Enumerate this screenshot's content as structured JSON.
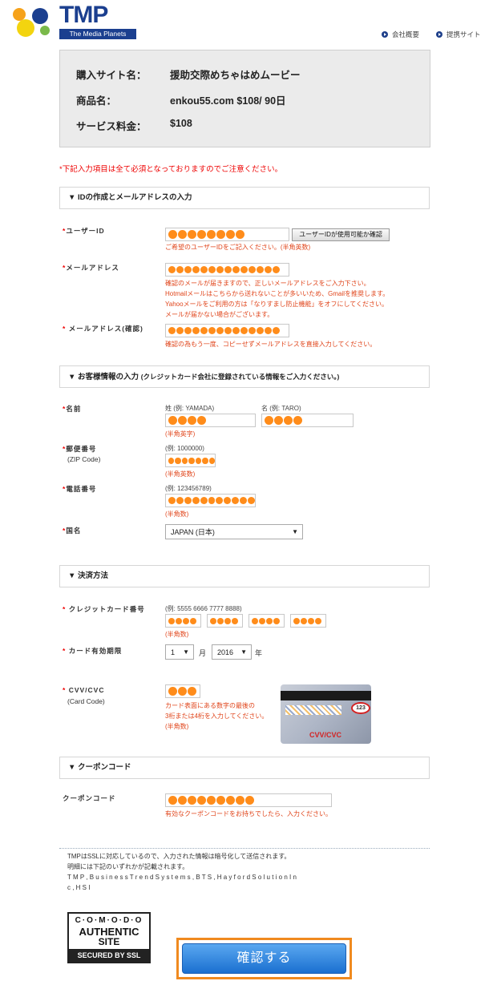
{
  "header": {
    "logo_text": "TMP",
    "logo_sub": "The Media Planets",
    "nav": [
      "会社概要",
      "提携サイト"
    ]
  },
  "summary": {
    "rows": [
      {
        "label": "購入サイト名：",
        "value": "援助交際めちゃはめムービー"
      },
      {
        "label": "商品名：",
        "value": "enkou55.com $108/ 90日"
      },
      {
        "label": "サービス料金：",
        "value": "$108"
      }
    ]
  },
  "notice": "*下記入力項目は全て必須となっておりますのでご注意ください。",
  "sections": {
    "account": "▼ IDの作成とメールアドレスの入力",
    "customer_main": "▼ お客様情報の入力",
    "customer_sub": "(クレジットカード会社に登録されている情報をご入力ください。)",
    "payment": "▼ 決済方法",
    "coupon": "▼ クーポンコード"
  },
  "fields": {
    "user_id": {
      "label": "ユーザーID",
      "check_button": "ユーザーIDが使用可能か確認",
      "hint": "ご希望のユーザーIDをご記入ください。(半角英数)"
    },
    "email": {
      "label": "メールアドレス",
      "hints": [
        "確認のメールが届きますので、正しいメールアドレスをご入力下さい。",
        "Hotmailメールはこちらから送れないことが多いいため、Gmailを推奨します。",
        "Yahooメールをご利用の方は「なりすまし防止機能」をオフにしてください。",
        "メールが届かない場合がございます。"
      ]
    },
    "email_confirm": {
      "label": "メールアドレス(確認)",
      "hint": "確認の為もう一度、コピーせずメールアドレスを直接入力してください。"
    },
    "name": {
      "label": "名前",
      "last_example": "姓 (例: YAMADA)",
      "first_example": "名 (例: TARO)",
      "hint": "(半角英字)"
    },
    "zip": {
      "label": "郵便番号",
      "sub": "(ZIP Code)",
      "example": "(例: 1000000)",
      "hint": "(半角英数)"
    },
    "phone": {
      "label": "電話番号",
      "example": "(例: 123456789)",
      "hint": "(半角数)"
    },
    "country": {
      "label": "国名",
      "value": "JAPAN (日本)"
    },
    "card_number": {
      "label": "クレジットカード番号",
      "example": "(例: 5555 6666 7777 8888)",
      "hint": "(半角数)"
    },
    "card_expiry": {
      "label": "カード有効期限",
      "month": "1",
      "month_unit": "月",
      "year": "2016",
      "year_unit": "年"
    },
    "cvv": {
      "label": "CVV/CVC",
      "sub": "(Card Code)",
      "hints": [
        "カード表面にある数字の最後の",
        "3桁または4桁を入力してください。",
        "(半角数)"
      ],
      "card_code": "123",
      "card_caption": "CVV/CVC"
    },
    "coupon": {
      "label": "クーポンコード",
      "hint": "有効なクーポンコードをお持ちでしたら、入力ください。"
    }
  },
  "footer": {
    "lines": [
      "TMPはSSLに対応しているので、入力された情報は暗号化して送信されます。",
      "明細には下記のいずれかが記載されます。",
      "T M P ,   B u s i n e s s   T r e n d   S y s t e m s ,   B T S ,   H a y f o r d   S o l u t i o n   I n",
      "c ,  H S I"
    ]
  },
  "badge": {
    "line1": "C·O·M·O·D·O",
    "line2": "AUTHENTIC",
    "line3": "SITE",
    "line4": "SECURED BY SSL"
  },
  "submit_label": "確認する",
  "colors": {
    "accent": "#ff8c1a",
    "error": "#e00000",
    "brand": "#1b3f8f"
  }
}
